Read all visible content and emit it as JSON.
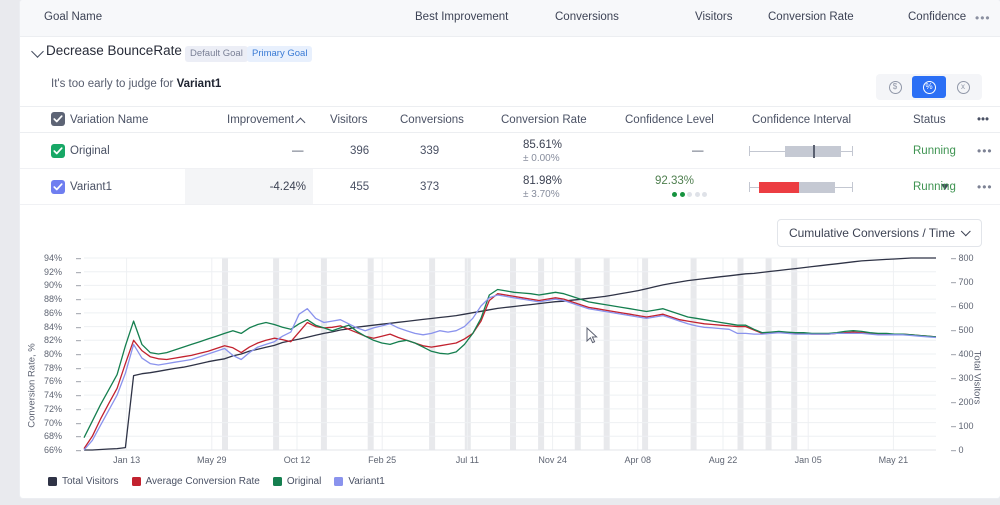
{
  "goal_header": {
    "columns": [
      "Goal Name",
      "Best Improvement",
      "Conversions",
      "Visitors",
      "Conversion Rate",
      "Confidence"
    ],
    "overflow_icon": "•••"
  },
  "goal": {
    "title": "Decrease BounceRate",
    "tag_default": "Default Goal",
    "tag_primary": "Primary Goal",
    "judge_prefix": "It's too early to judge for ",
    "judge_variant": "Variant1"
  },
  "metric_toggle": {
    "options": [
      {
        "name": "currency",
        "glyph": "$",
        "active": false
      },
      {
        "name": "percent",
        "glyph": "%",
        "active": true
      },
      {
        "name": "absolute",
        "glyph": "x",
        "active": false
      }
    ]
  },
  "variations_table": {
    "columns": {
      "name": "Variation Name",
      "improvement": "Improvement",
      "visitors": "Visitors",
      "conversions": "Conversions",
      "conversion_rate": "Conversion Rate",
      "confidence_level": "Confidence Level",
      "confidence_interval": "Confidence Interval",
      "status": "Status",
      "overflow": "•••"
    },
    "sort": {
      "column": "Improvement",
      "direction": "asc",
      "icon": "caret-up"
    },
    "rows": [
      {
        "name": "Original",
        "checkbox_color": "#17a866",
        "improvement": "—",
        "improvement_direction": "none",
        "visitors": "396",
        "conversions": "339",
        "conversion_rate": "85.61%",
        "conversion_rate_margin": "± 0.00%",
        "confidence_level": "—",
        "confidence_dots_filled": 0,
        "confidence_dots_total": 5,
        "status": "Running",
        "overflow": "•••"
      },
      {
        "name": "Variant1",
        "checkbox_color": "#6f7ef0",
        "improvement": "-4.24%",
        "improvement_direction": "down",
        "visitors": "455",
        "conversions": "373",
        "conversion_rate": "81.98%",
        "conversion_rate_margin": "± 3.70%",
        "confidence_level": "92.33%",
        "confidence_dots_filled": 2,
        "confidence_dots_total": 5,
        "status": "Running",
        "overflow": "•••"
      }
    ]
  },
  "chart_selector": {
    "value": "Cumulative Conversions / Time",
    "icon": "chevron-down-icon"
  },
  "chart_data": {
    "type": "line",
    "title": "",
    "xlabel": "",
    "ylabel": "Conversion Rate, %",
    "y2label": "Total Visitors",
    "grid": true,
    "legend_position": "bottom-left",
    "ylim": [
      66,
      94
    ],
    "y2lim": [
      0,
      800
    ],
    "yticks": [
      "66%",
      "68%",
      "70%",
      "72%",
      "74%",
      "76%",
      "78%",
      "80%",
      "82%",
      "84%",
      "86%",
      "88%",
      "90%",
      "92%",
      "94%"
    ],
    "y2ticks": [
      "0",
      "100",
      "200",
      "300",
      "400",
      "500",
      "600",
      "700",
      "800"
    ],
    "xticks": [
      "Jan 13",
      "May 29",
      "Oct 12",
      "Feb 25",
      "Jul 11",
      "Nov 24",
      "Apr 08",
      "Aug 22",
      "Jan 05",
      "May 21"
    ],
    "series": [
      {
        "name": "Total Visitors",
        "color": "#2f3346",
        "axis": "right",
        "values": [
          0,
          0,
          2,
          4,
          6,
          10,
          310,
          318,
          322,
          328,
          334,
          340,
          345,
          352,
          360,
          368,
          374,
          380,
          392,
          400,
          412,
          420,
          428,
          436,
          448,
          455,
          462,
          470,
          478,
          486,
          492,
          500,
          505,
          512,
          516,
          520,
          524,
          528,
          532,
          536,
          540,
          544,
          548,
          552,
          556,
          560,
          566,
          572,
          578,
          584,
          590,
          594,
          598,
          602,
          606,
          610,
          614,
          618,
          620,
          624,
          628,
          632,
          636,
          640,
          646,
          652,
          658,
          664,
          672,
          680,
          688,
          694,
          700,
          706,
          710,
          714,
          718,
          722,
          726,
          730,
          734,
          736,
          740,
          744,
          748,
          752,
          756,
          760,
          764,
          768,
          772,
          776,
          780,
          784,
          788,
          790,
          792,
          794,
          796,
          798,
          800,
          800,
          800,
          800
        ]
      },
      {
        "name": "Average Conversion Rate",
        "color": "#c2222f",
        "axis": "left",
        "values": [
          66.2,
          68.0,
          70.5,
          72.8,
          75.0,
          78.6,
          82.0,
          80.5,
          79.6,
          79.3,
          79.2,
          79.4,
          79.6,
          79.8,
          80.1,
          80.4,
          80.8,
          81.2,
          80.9,
          80.2,
          81.0,
          81.6,
          82.0,
          82.3,
          82.1,
          81.8,
          83.2,
          84.6,
          84.0,
          83.8,
          83.9,
          84.1,
          83.6,
          83.1,
          82.6,
          82.3,
          82.6,
          82.9,
          82.4,
          82.0,
          81.6,
          81.2,
          81.0,
          81.2,
          81.4,
          81.6,
          82.2,
          83.0,
          84.8,
          87.8,
          88.8,
          88.6,
          88.4,
          88.2,
          88.0,
          87.8,
          88.0,
          88.2,
          88.0,
          87.6,
          87.2,
          86.8,
          86.6,
          86.4,
          86.2,
          86.0,
          85.8,
          85.6,
          85.4,
          85.6,
          85.8,
          85.4,
          85.0,
          84.8,
          84.6,
          84.4,
          84.3,
          84.2,
          84.1,
          84.0,
          84.0,
          83.5,
          83.0,
          83.1,
          83.2,
          83.1,
          83.0,
          83.0,
          82.9,
          82.9,
          82.9,
          83.0,
          83.1,
          83.2,
          83.1,
          83.0,
          82.9,
          82.9,
          82.9,
          82.9,
          82.8,
          82.7,
          82.6,
          82.5
        ]
      },
      {
        "name": "Original",
        "color": "#157f4f",
        "axis": "left",
        "values": [
          67.8,
          70.2,
          72.6,
          74.8,
          77.0,
          81.2,
          84.8,
          81.4,
          80.2,
          80.0,
          80.2,
          80.6,
          81.0,
          81.4,
          81.8,
          82.2,
          82.6,
          83.0,
          83.4,
          83.0,
          83.8,
          84.3,
          84.6,
          84.3,
          83.9,
          83.6,
          84.4,
          85.0,
          84.2,
          83.8,
          83.4,
          83.8,
          84.2,
          83.3,
          82.6,
          82.0,
          81.6,
          81.4,
          81.8,
          82.0,
          81.6,
          81.0,
          80.4,
          80.1,
          80.0,
          80.3,
          81.4,
          83.0,
          85.2,
          88.6,
          89.4,
          89.2,
          89.0,
          88.9,
          88.8,
          88.6,
          88.8,
          89.0,
          88.8,
          88.4,
          88.0,
          87.6,
          87.4,
          87.2,
          87.0,
          86.8,
          86.6,
          86.4,
          86.2,
          86.4,
          86.6,
          86.2,
          85.8,
          85.4,
          85.2,
          85.0,
          84.8,
          84.6,
          84.4,
          84.2,
          84.2,
          83.6,
          83.1,
          83.2,
          83.3,
          83.2,
          83.1,
          83.1,
          83.0,
          83.0,
          83.0,
          83.1,
          83.3,
          83.4,
          83.3,
          83.1,
          83.0,
          83.0,
          82.9,
          82.9,
          82.8,
          82.7,
          82.6,
          82.5
        ]
      },
      {
        "name": "Variant1",
        "color": "#8a93ed",
        "axis": "left",
        "values": [
          66.0,
          67.4,
          69.6,
          71.8,
          74.0,
          77.2,
          81.4,
          79.4,
          78.6,
          78.4,
          78.6,
          78.8,
          79.0,
          79.2,
          79.6,
          80.0,
          80.4,
          80.8,
          79.8,
          79.2,
          80.2,
          81.0,
          81.4,
          81.8,
          82.6,
          83.2,
          85.8,
          86.6,
          85.2,
          84.6,
          84.8,
          85.0,
          84.4,
          83.8,
          83.4,
          83.8,
          84.1,
          84.4,
          83.8,
          83.4,
          83.0,
          82.8,
          83.0,
          83.4,
          83.2,
          83.4,
          84.0,
          85.2,
          87.0,
          88.2,
          88.6,
          88.4,
          88.2,
          88.0,
          87.8,
          87.6,
          87.8,
          88.0,
          87.8,
          87.4,
          87.0,
          86.6,
          86.4,
          86.2,
          86.0,
          85.8,
          85.6,
          85.4,
          85.2,
          85.4,
          85.6,
          85.2,
          84.8,
          84.4,
          84.1,
          83.9,
          83.8,
          83.7,
          83.6,
          83.0,
          83.0,
          82.9,
          82.9,
          83.0,
          83.1,
          83.0,
          82.9,
          82.9,
          82.9,
          82.9,
          82.9,
          83.0,
          83.0,
          83.0,
          83.0,
          82.9,
          82.8,
          82.8,
          82.8,
          82.8,
          82.7,
          82.6,
          82.5,
          82.4
        ]
      }
    ],
    "highlight_bands": [
      0.162,
      0.222,
      0.278,
      0.333,
      0.405,
      0.447,
      0.5,
      0.533,
      0.576,
      0.61,
      0.655,
      0.712,
      0.767,
      0.8,
      0.83
    ]
  },
  "legend": [
    {
      "label": "Total Visitors",
      "color": "#2f3346"
    },
    {
      "label": "Average Conversion Rate",
      "color": "#c2222f"
    },
    {
      "label": "Original",
      "color": "#157f4f"
    },
    {
      "label": "Variant1",
      "color": "#8a93ed"
    }
  ]
}
